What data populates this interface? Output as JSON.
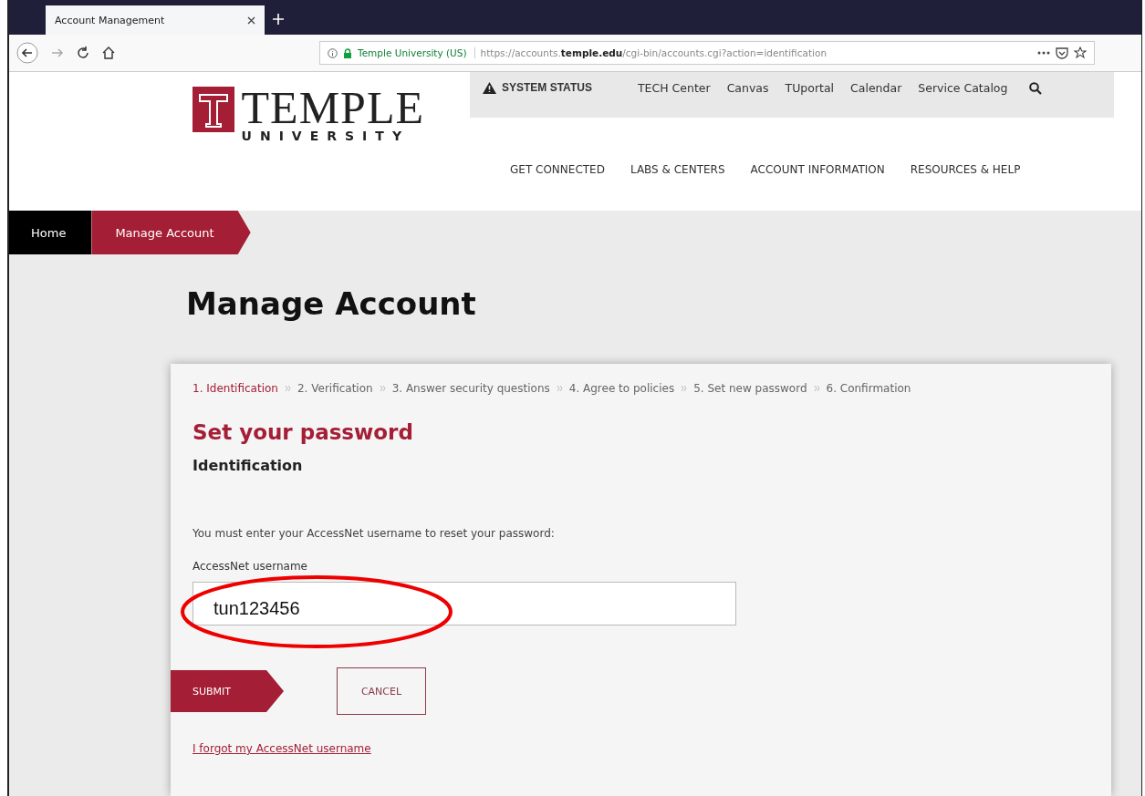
{
  "browser": {
    "tab_title": "Account Management",
    "site_identity": "Temple University (US)",
    "url": "https://accounts.**temple.edu**/cgi-bin/accounts.cgi?action=identification"
  },
  "header": {
    "logo": {
      "name": "TEMPLE",
      "subtitle": "UNIVERSITY"
    },
    "utility_links": [
      {
        "kind": "status",
        "label": "SYSTEM STATUS"
      },
      {
        "kind": "link",
        "label": "TECH Center"
      },
      {
        "kind": "link",
        "label": "Canvas"
      },
      {
        "kind": "link",
        "label": "TUportal"
      },
      {
        "kind": "link",
        "label": "Calendar"
      },
      {
        "kind": "link",
        "label": "Service Catalog"
      }
    ],
    "main_nav": [
      "GET CONNECTED",
      "LABS & CENTERS",
      "ACCOUNT INFORMATION",
      "RESOURCES & HELP"
    ]
  },
  "breadcrumb": [
    {
      "label": "Home",
      "selected": false
    },
    {
      "label": "Manage Account",
      "selected": true
    }
  ],
  "page_title": "Manage Account",
  "steps": [
    {
      "label": "1. Identification",
      "selected": true
    },
    {
      "label": "2. Verification",
      "selected": false
    },
    {
      "label": "3. Answer security questions",
      "selected": false
    },
    {
      "label": "4. Agree to policies",
      "selected": false
    },
    {
      "label": "5. Set new password",
      "selected": false
    },
    {
      "label": "6. Confirmation",
      "selected": false
    }
  ],
  "form": {
    "title": "Set your password",
    "subtitle": "Identification",
    "instruction": "You must enter your AccessNet username to reset your password:",
    "field_label": "AccessNet username",
    "field_value": "tun123456",
    "submit": "SUBMIT",
    "cancel": "CANCEL",
    "forgot_link": "I forgot my AccessNet username"
  }
}
